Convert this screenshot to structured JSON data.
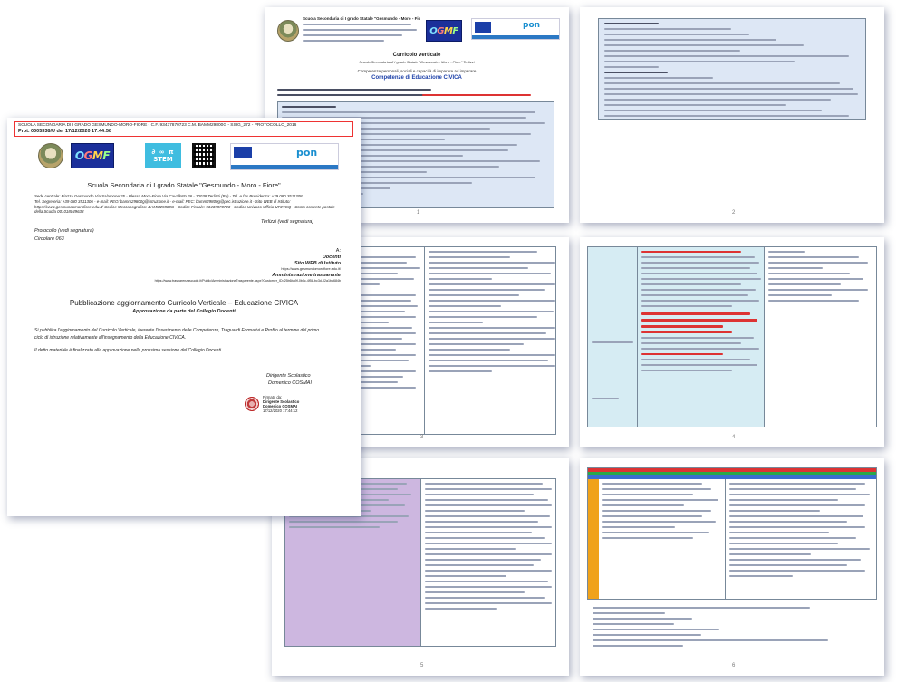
{
  "front_letter": {
    "header_line": "SCUOLA SECONDARIA DI I GRADO GESMUNDO-MORO-FIORE - C.F. 93437870723 C.M. BAMM29800G - SSIG_272 - PROTOCOLLO_2016",
    "protocol": "Prot. 0005338/U del 17/12/2020 17:44:58",
    "stem_label": "STEM",
    "school_name": "Scuola Secondaria di I grado Statale \"Gesmundo - Moro - Fiore\"",
    "contact_1": "Sede centrale: Piazza Gesmundo Via Salamone 25 - Plesso Moro-Fiore Via Cavallotto 26 - 70038 Terlizzi (Ba) - Tel. e fax Presidenza: +39 080 3511308",
    "contact_2": "Tel. Segreteria: +39 080 3511306 - e-mail: PEO: bamm29800g@istruzione.it - e-mail: PEC: bamm29800g@pec.istruzione.it - Sito WEB di Istituto:",
    "contact_3": "https://www.gesmundomorofiore.edu.it/ Codice Meccanografico: BAMM29800G - Codice Fiscale: 93437870723 - Codice Univoco Ufficio UF2TGQ - Conto corrente postale della Scuola 001018049638",
    "signature_note": "Terlizzi (vedi segnatura)",
    "protocollo": "Protocollo (vedi segnatura)",
    "circolare": "Circolare 063",
    "to_a": "A:",
    "to_docenti": "Docenti",
    "to_sito": "Sito WEB di Istituto",
    "to_amm": "Amministrazione trasparente",
    "link_1": "https://www.gesmundomorofiore.edu.it/",
    "link_2": "https://www.trasparenzascuole.it/Public/AmministrazioneTrasparente.aspx?Customer_ID=25b6ba9f-0b0c-4f58-bc3d-02a1ba684b",
    "subject": "Pubblicazione aggiornamento Curricolo Verticale – Educazione CIVICA",
    "subject_sub": "Approvazione da parte del Collegio Docenti",
    "body_1": "Si pubblica l'aggiornamento del Curricolo Verticale, inerente l'inserimento delle Competenze, Traguardi Formativi e Profilo al termine del primo",
    "body_2": "ciclo di istruzione relativamente all'insegnamento della Educazione CIVICA.",
    "body_3": "Il detto materiale è finalizzato alla approvazione nella prossima sessione del Collegio Docenti",
    "signer_role": "Dirigente Scolastico",
    "signer_name": "Domenico COSMAI",
    "sig_1": "Firmato da:",
    "sig_2": "Dirigente Scolastico",
    "sig_3": "Domenico COSMAI",
    "sig_4": "17/12/2020 17:44:12"
  },
  "page1": {
    "school": "Scuola Secondaria di I grado Statale \"Gesmundo - Moro - Fiore\"",
    "title": "Curricolo verticale",
    "subtitle": "Scuola Secondaria di I grado Statale \"Gesmundo - Moro - Fiore\" Terlizzi",
    "line_a": "Competenze personali, sociali e capacità di imparare ad imparare",
    "competenze": "Competenze di Educazione CIVICA",
    "number": "1"
  },
  "page_numbers": [
    "2",
    "3",
    "4",
    "5",
    "6"
  ],
  "colors": {
    "shadow": "#3c466e",
    "light_blue_fill": "#d7e3f3",
    "purple_fill": "#c9b3dc",
    "red_text": "#d33333",
    "ogmf_blue": "#1b2f9a"
  }
}
